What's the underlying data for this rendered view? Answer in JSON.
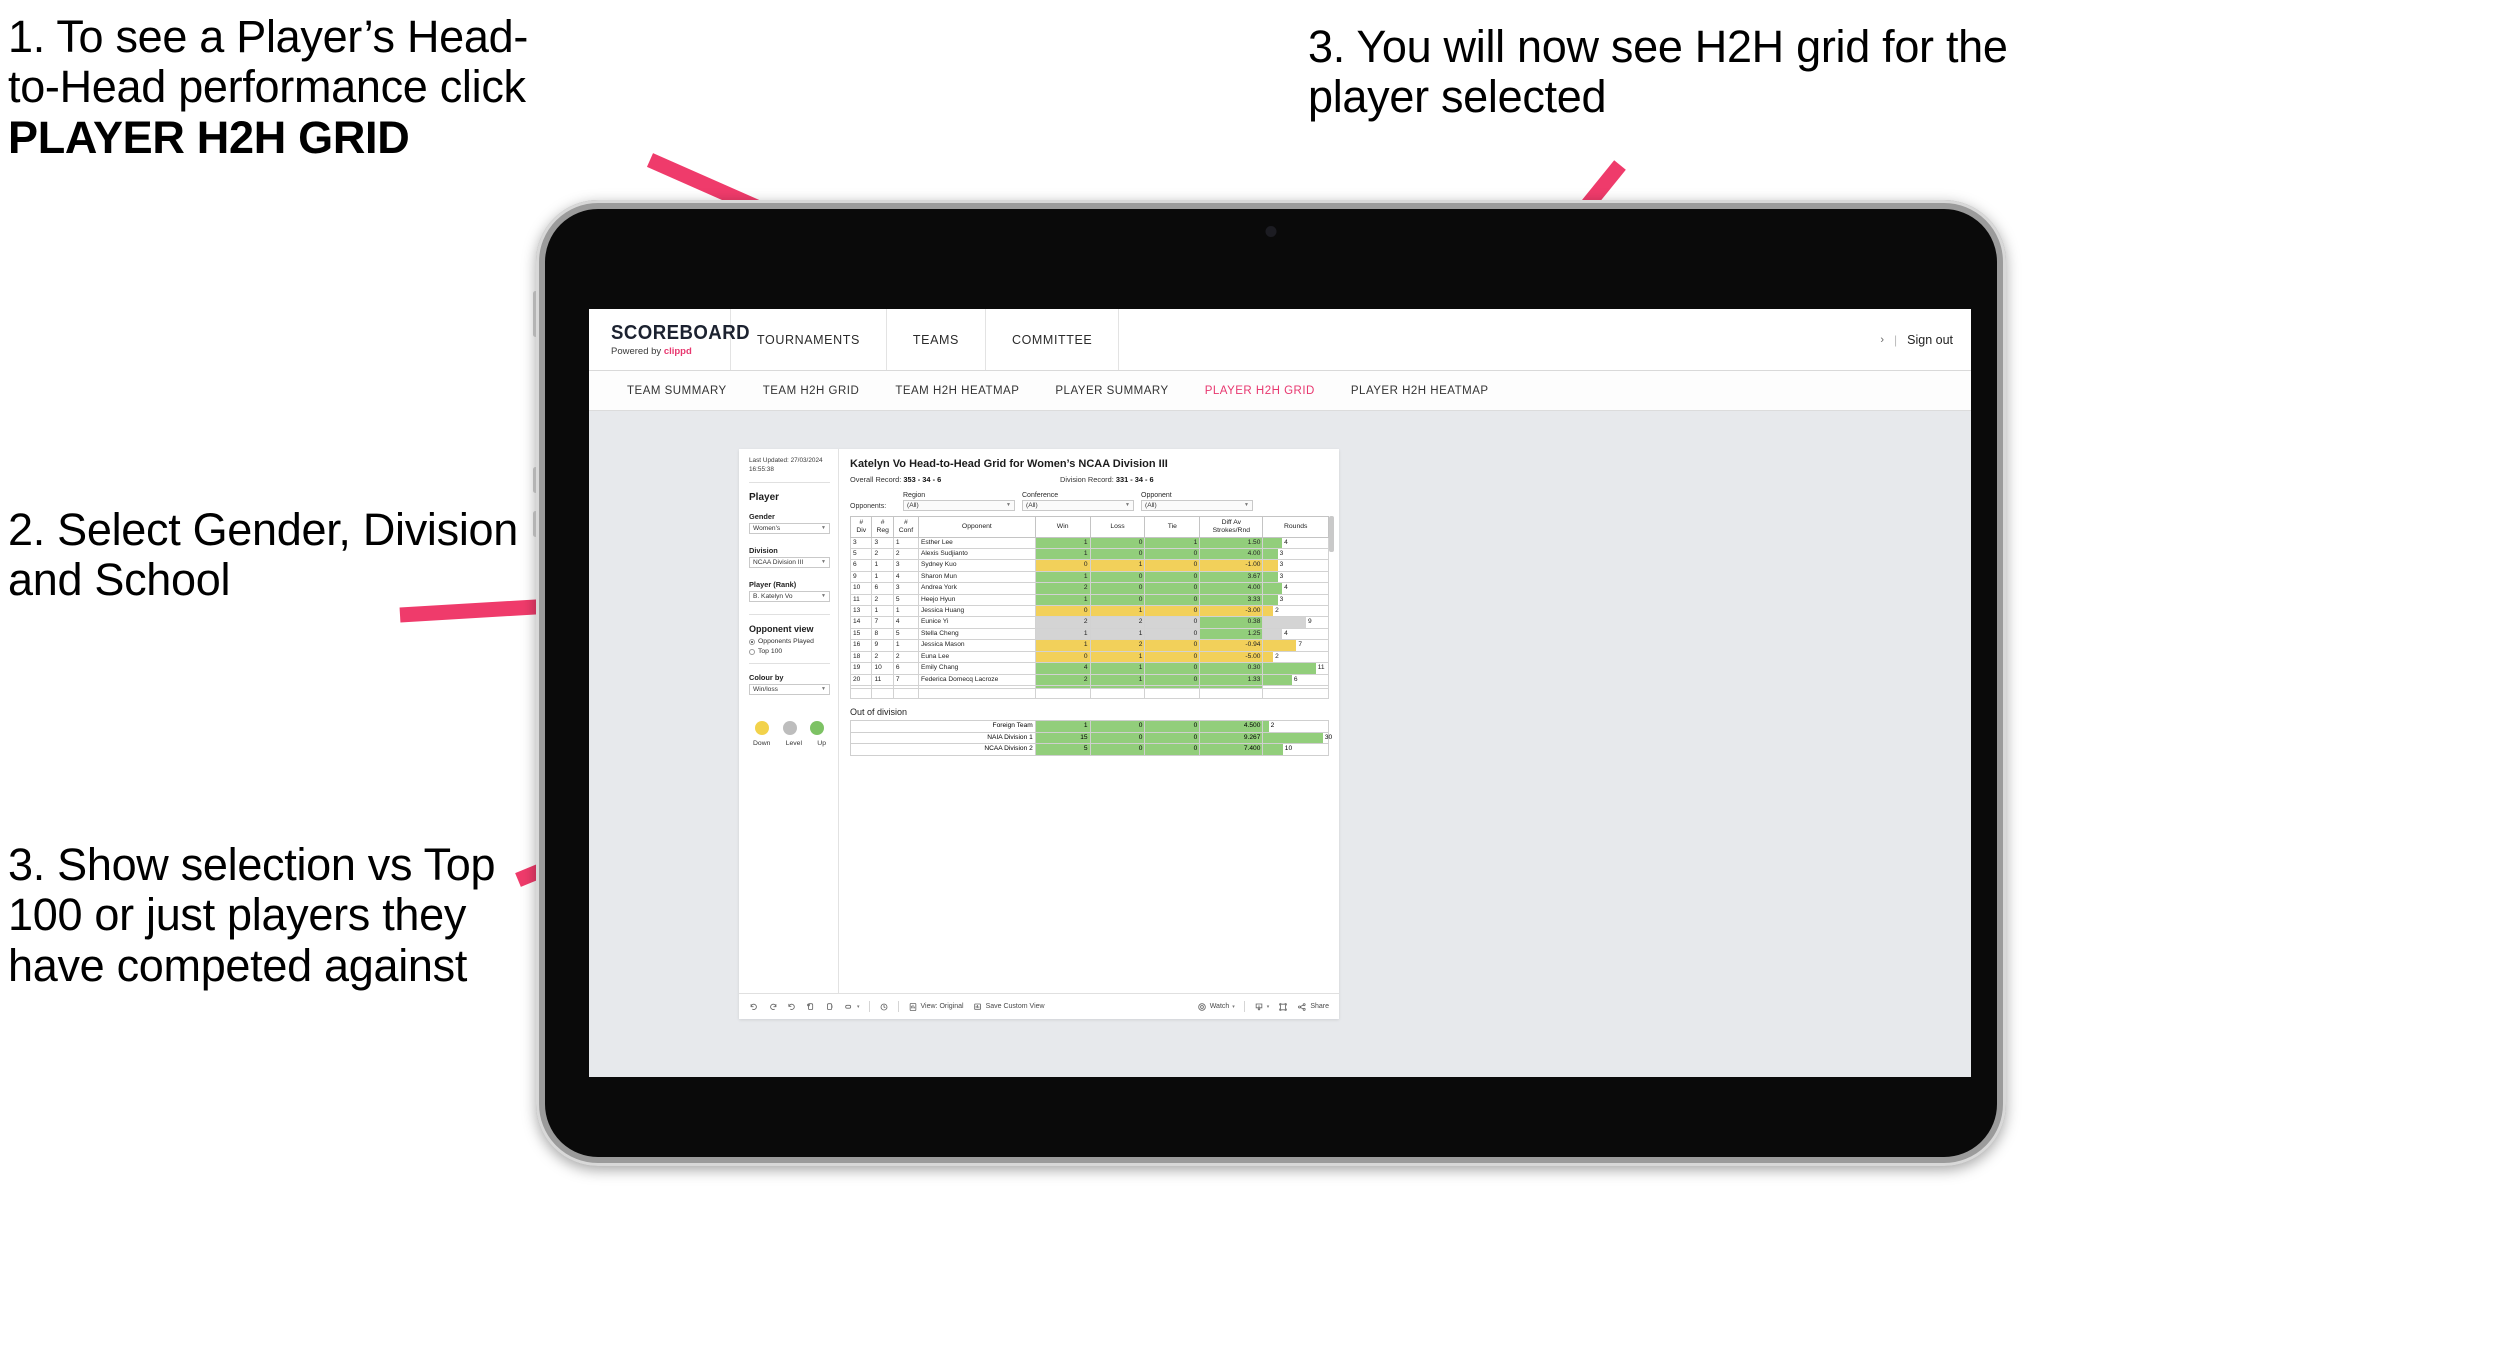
{
  "annotations": [
    {
      "id": "anno-1",
      "line1": "1. To see a Player’s Head-",
      "line2": "to-Head performance click",
      "bold": "PLAYER H2H GRID"
    },
    {
      "id": "anno-2",
      "text": "2. Select Gender, Division and School"
    },
    {
      "id": "anno-3",
      "text": "3. Show selection vs Top 100 or just players they have competed against"
    },
    {
      "id": "anno-4",
      "text": "3. You will now see H2H grid for the player selected"
    }
  ],
  "arrow_color": "#ef3b6b",
  "app": {
    "brand": {
      "title": "SCOREBOARD",
      "sub_prefix": "Powered by ",
      "sub_brand": "clippd"
    },
    "topnav": [
      "TOURNAMENTS",
      "TEAMS",
      "COMMITTEE"
    ],
    "header_right": {
      "chevron": "›",
      "separator": "|",
      "signout": "Sign out"
    },
    "subnav": [
      {
        "label": "TEAM SUMMARY",
        "active": false
      },
      {
        "label": "TEAM H2H GRID",
        "active": false
      },
      {
        "label": "TEAM H2H HEATMAP",
        "active": false
      },
      {
        "label": "PLAYER SUMMARY",
        "active": false
      },
      {
        "label": "PLAYER H2H GRID",
        "active": true
      },
      {
        "label": "PLAYER H2H HEATMAP",
        "active": false
      }
    ]
  },
  "filters": {
    "last_updated": "Last Updated: 27/03/2024 16:55:38",
    "section_title": "Player",
    "gender": {
      "label": "Gender",
      "value": "Women's"
    },
    "division": {
      "label": "Division",
      "value": "NCAA Division III"
    },
    "player": {
      "label": "Player (Rank)",
      "value": "B. Katelyn Vo"
    },
    "opponent_view": {
      "title": "Opponent view",
      "options": [
        {
          "label": "Opponents Played",
          "selected": true
        },
        {
          "label": "Top 100",
          "selected": false
        }
      ]
    },
    "colour_by": {
      "label": "Colour by",
      "value": "Win/loss"
    },
    "legend": [
      {
        "label": "Down",
        "color": "#f2d24b"
      },
      {
        "label": "Level",
        "color": "#bdbdbd"
      },
      {
        "label": "Up",
        "color": "#7dc264"
      }
    ]
  },
  "viz": {
    "title": "Katelyn Vo Head-to-Head Grid for Women’s NCAA Division III",
    "overall_record_label": "Overall Record:",
    "overall_record_value": "353 -  34 - 6",
    "division_record_label": "Division Record:",
    "division_record_value": "331 -  34 - 6",
    "opponents_label": "Opponents:",
    "opponent_filters": [
      {
        "label": "Region",
        "value": "(All)"
      },
      {
        "label": "Conference",
        "value": "(All)"
      },
      {
        "label": "Opponent",
        "value": "(All)"
      }
    ],
    "columns": [
      "# Div",
      "# Reg",
      "# Conf",
      "Opponent",
      "Win",
      "Loss",
      "Tie",
      "Diff Av Strokes/Rnd",
      "Rounds"
    ],
    "columns_split": [
      {
        "top": "#",
        "bottom": "Div"
      },
      {
        "top": "#",
        "bottom": "Reg"
      },
      {
        "top": "#",
        "bottom": "Conf"
      },
      {
        "top": "Opponent",
        "bottom": ""
      },
      {
        "top": "Win",
        "bottom": ""
      },
      {
        "top": "Loss",
        "bottom": ""
      },
      {
        "top": "Tie",
        "bottom": ""
      },
      {
        "top": "Diff Av",
        "bottom": "Strokes/Rnd"
      },
      {
        "top": "Rounds",
        "bottom": ""
      }
    ],
    "rows": [
      {
        "div": "3",
        "reg": "3",
        "conf": "1",
        "opponent": "Esther Lee",
        "win": "1",
        "loss": "0",
        "tie": "1",
        "diff": "1.50",
        "rounds": "4",
        "color": "green",
        "bar_pct": 29
      },
      {
        "div": "5",
        "reg": "2",
        "conf": "2",
        "opponent": "Alexis Sudjianto",
        "win": "1",
        "loss": "0",
        "tie": "0",
        "diff": "4.00",
        "rounds": "3",
        "color": "green",
        "bar_pct": 22
      },
      {
        "div": "6",
        "reg": "1",
        "conf": "3",
        "opponent": "Sydney Kuo",
        "win": "0",
        "loss": "1",
        "tie": "0",
        "diff": "-1.00",
        "rounds": "3",
        "color": "yellow",
        "bar_pct": 22
      },
      {
        "div": "9",
        "reg": "1",
        "conf": "4",
        "opponent": "Sharon Mun",
        "win": "1",
        "loss": "0",
        "tie": "0",
        "diff": "3.67",
        "rounds": "3",
        "color": "green",
        "bar_pct": 22
      },
      {
        "div": "10",
        "reg": "6",
        "conf": "3",
        "opponent": "Andrea York",
        "win": "2",
        "loss": "0",
        "tie": "0",
        "diff": "4.00",
        "rounds": "4",
        "color": "green",
        "bar_pct": 29
      },
      {
        "div": "11",
        "reg": "2",
        "conf": "5",
        "opponent": "Heejo Hyun",
        "win": "1",
        "loss": "0",
        "tie": "0",
        "diff": "3.33",
        "rounds": "3",
        "color": "green",
        "bar_pct": 22
      },
      {
        "div": "13",
        "reg": "1",
        "conf": "1",
        "opponent": "Jessica Huang",
        "win": "0",
        "loss": "1",
        "tie": "0",
        "diff": "-3.00",
        "rounds": "2",
        "color": "yellow",
        "bar_pct": 15
      },
      {
        "div": "14",
        "reg": "7",
        "conf": "4",
        "opponent": "Eunice Yi",
        "win": "2",
        "loss": "2",
        "tie": "0",
        "diff": "0.38",
        "rounds": "9",
        "color": "grey",
        "bar_pct": 66,
        "diff_color": "green"
      },
      {
        "div": "15",
        "reg": "8",
        "conf": "5",
        "opponent": "Stella Cheng",
        "win": "1",
        "loss": "1",
        "tie": "0",
        "diff": "1.25",
        "rounds": "4",
        "color": "grey",
        "bar_pct": 29,
        "diff_color": "green"
      },
      {
        "div": "16",
        "reg": "9",
        "conf": "1",
        "opponent": "Jessica Mason",
        "win": "1",
        "loss": "2",
        "tie": "0",
        "diff": "-0.94",
        "rounds": "7",
        "color": "yellow",
        "bar_pct": 51
      },
      {
        "div": "18",
        "reg": "2",
        "conf": "2",
        "opponent": "Euna Lee",
        "win": "0",
        "loss": "1",
        "tie": "0",
        "diff": "-5.00",
        "rounds": "2",
        "color": "yellow",
        "bar_pct": 15
      },
      {
        "div": "19",
        "reg": "10",
        "conf": "6",
        "opponent": "Emily Chang",
        "win": "4",
        "loss": "1",
        "tie": "0",
        "diff": "0.30",
        "rounds": "11",
        "color": "green",
        "bar_pct": 81
      },
      {
        "div": "20",
        "reg": "11",
        "conf": "7",
        "opponent": "Federica Domecq Lacroze",
        "win": "2",
        "loss": "1",
        "tie": "0",
        "diff": "1.33",
        "rounds": "6",
        "color": "green",
        "bar_pct": 44
      }
    ],
    "out_of_division": {
      "title": "Out of division",
      "rows": [
        {
          "name": "Foreign Team",
          "win": "1",
          "loss": "0",
          "tie": "0",
          "diff": "4.500",
          "rounds": "2",
          "color": "green",
          "bar_pct": 8
        },
        {
          "name": "NAIA Division 1",
          "win": "15",
          "loss": "0",
          "tie": "0",
          "diff": "9.267",
          "rounds": "30",
          "color": "green",
          "bar_pct": 92
        },
        {
          "name": "NCAA Division 2",
          "win": "5",
          "loss": "0",
          "tie": "0",
          "diff": "7.400",
          "rounds": "10",
          "color": "green",
          "bar_pct": 30
        }
      ]
    }
  },
  "toolbar": {
    "view_label": "View: Original",
    "save_label": "Save Custom View",
    "watch_label": "Watch",
    "share_label": "Share",
    "caret": "▾"
  }
}
